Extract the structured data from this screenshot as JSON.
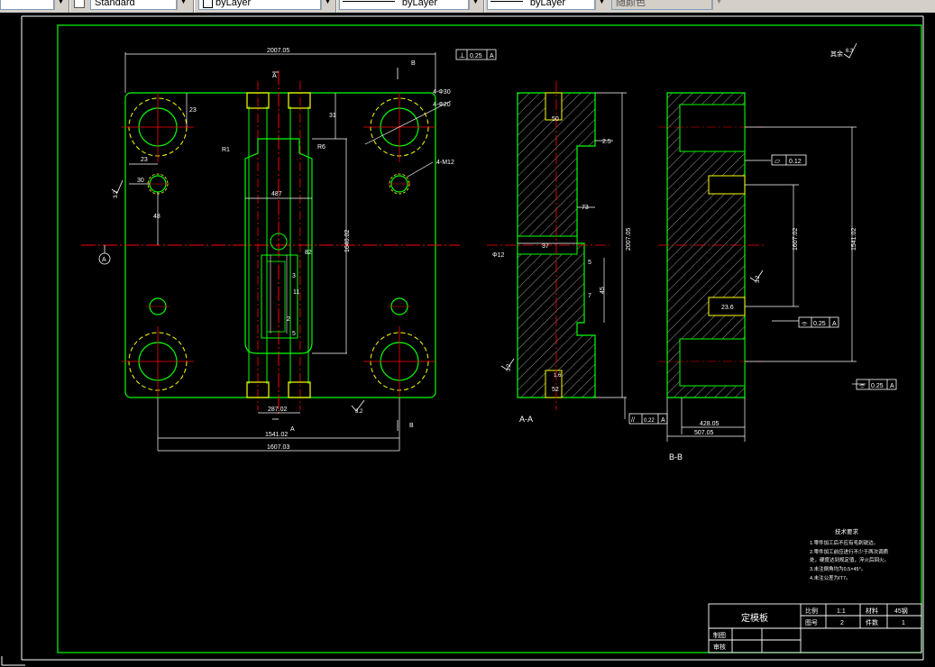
{
  "toolbar": {
    "text_style": "Standard",
    "layer": "byLayer",
    "linetype": "byLayer",
    "lineweight": "byLayer",
    "color": "随颜色"
  },
  "drawing": {
    "dims_main": {
      "overall_width": "2007.05",
      "lower_width": "1607.03",
      "hole_span": "1541.02",
      "center_span": "287.02",
      "height_right": "1640.02",
      "d23_a": "23",
      "d23_b": "23",
      "d30": "30",
      "d48": "48",
      "d31": "31",
      "d487": "487",
      "d82": "82",
      "d5": "5",
      "d11": "11",
      "d2": "2",
      "d3": "3",
      "r1": "R1",
      "r6": "R6"
    },
    "callouts": {
      "holes_4_30": "4-Φ30",
      "holes_4_20": "4-Φ20",
      "thread": "4-M12",
      "flatness_symbol": "▱",
      "flatness_value": "0.12",
      "perp_symbol": "⊥",
      "sym_symbol": "⌯",
      "datum_a": "A",
      "datum_b": "B",
      "tol_025": "0.25",
      "tol_022": "0.22",
      "parallel_symbol": "//"
    },
    "roughness": {
      "r32a": "3.2",
      "r32b": "3.2",
      "r32c": "3.2",
      "r32d": "3.2",
      "r16": "1.6",
      "corner_label": "其余",
      "corner_value": "6.3"
    },
    "section_aa": {
      "label": "A-A",
      "height": "2007.05",
      "d37": "37",
      "d73": "73",
      "d25": "2.5",
      "d5": "5",
      "d7": "7",
      "d45": "45",
      "bore": "Φ12",
      "d50": "50",
      "d52": "52"
    },
    "section_bb": {
      "label": "B-B",
      "width_inner": "428.05",
      "width_outer": "507.05",
      "h_a": "1607.02",
      "h_b": "1541.02",
      "d236": "23.6"
    },
    "tech_req": {
      "title": "技术要求",
      "lines": [
        "1.零件加工后不应有毛刺锐边。",
        "2.零件加工前应进行不少于两次调质",
        "  处，硬度达到规定值，淬火后回火。",
        "3.未注倒角均为0.5×45°。",
        "4.未注公差为IT7。"
      ]
    },
    "title_block": {
      "name": "定模板",
      "scale_label": "比例",
      "scale_value": "1:1",
      "material_label": "材料",
      "material_value": "45钢",
      "drawing_no_label": "图号",
      "drawing_no_value": "2",
      "qty_label": "件数",
      "qty_value": "1",
      "drawn_label": "制图",
      "checked_label": "审核"
    }
  }
}
